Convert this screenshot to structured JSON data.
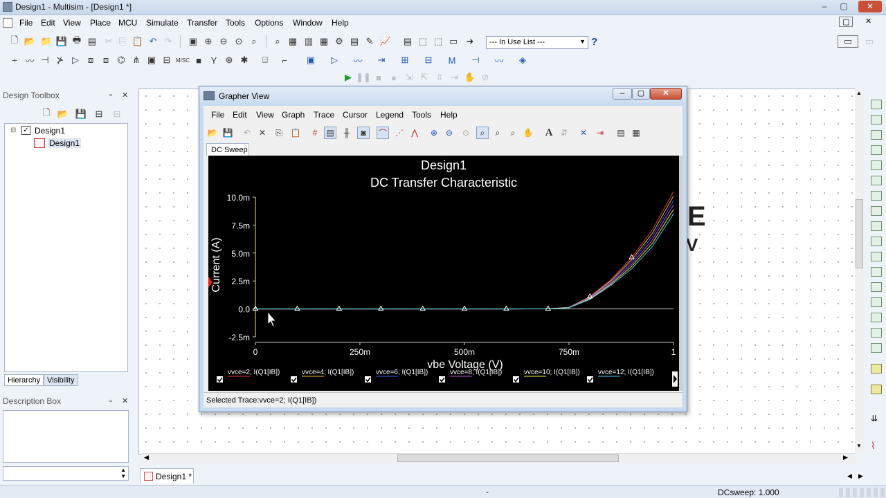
{
  "window": {
    "title": "Design1 - Multisim - [Design1 *]",
    "controls": [
      "–",
      "▢",
      "✕"
    ]
  },
  "menu": [
    "File",
    "Edit",
    "View",
    "Place",
    "MCU",
    "Simulate",
    "Transfer",
    "Tools",
    "Options",
    "Window",
    "Help"
  ],
  "toolbar": {
    "in_use_list": "--- In Use List ---",
    "help": "?"
  },
  "design_toolbox": {
    "title": "Design Toolbox",
    "tree": {
      "root": "Design1",
      "child": "Design1"
    },
    "tabs": [
      "Hierarchy",
      "Visibility"
    ]
  },
  "description_box": {
    "title": "Description Box"
  },
  "workspace": {
    "partial_text": [
      "E",
      "V"
    ]
  },
  "document_tab": "Design1 *",
  "statusbar": {
    "left": "-",
    "right": "DCsweep: 1.000"
  },
  "grapher": {
    "title": "Grapher View",
    "menu": [
      "File",
      "Edit",
      "View",
      "Graph",
      "Trace",
      "Cursor",
      "Legend",
      "Tools",
      "Help"
    ],
    "tab": "DC Sweep",
    "status": "Selected Trace:vvce=2; I(Q1[IB])"
  },
  "chart_data": {
    "type": "line",
    "title": "Design1",
    "subtitle": "DC Transfer Characteristic",
    "xlabel": "vbe Voltage (V)",
    "ylabel": "Current (A)",
    "xlim": [
      0,
      1
    ],
    "ylim": [
      -0.0025,
      0.01
    ],
    "x_ticks": [
      "0",
      "250m",
      "500m",
      "750m",
      "1"
    ],
    "y_ticks": [
      "10.0m",
      "7.5m",
      "5.0m",
      "2.5m",
      "0.0",
      "-2.5m"
    ],
    "grid": false,
    "legend_position": "bottom",
    "x": [
      0,
      0.1,
      0.2,
      0.3,
      0.4,
      0.5,
      0.6,
      0.7,
      0.75,
      0.8,
      0.85,
      0.9,
      0.95,
      1.0
    ],
    "series": [
      {
        "name": "vvce=2; I(Q1[IB])",
        "color": "#e03a3a",
        "values": [
          0,
          0,
          0,
          0,
          0,
          0,
          0,
          1e-05,
          0.00015,
          0.0011,
          0.0026,
          0.0046,
          0.0071,
          0.0105
        ]
      },
      {
        "name": "vvce=4; I(Q1[IB])",
        "color": "#f0b43c",
        "values": [
          0,
          0,
          0,
          0,
          0,
          0,
          0,
          1e-05,
          0.00014,
          0.00105,
          0.0025,
          0.0044,
          0.0068,
          0.0101
        ]
      },
      {
        "name": "vvce=6; I(Q1[IB])",
        "color": "#3a52e8",
        "values": [
          0,
          0,
          0,
          0,
          0,
          0,
          0,
          1e-05,
          0.00013,
          0.001,
          0.0024,
          0.0042,
          0.0065,
          0.0097
        ]
      },
      {
        "name": "vvce=8; I(Q1[IB])",
        "color": "#b655d6",
        "values": [
          0,
          0,
          0,
          0,
          0,
          0,
          0,
          1e-05,
          0.00012,
          0.00095,
          0.0023,
          0.004,
          0.0062,
          0.0093
        ]
      },
      {
        "name": "vvce=10; I(Q1[IB])",
        "color": "#e8e84a",
        "values": [
          0,
          0,
          0,
          0,
          0,
          0,
          0,
          1e-05,
          0.00011,
          0.0009,
          0.0022,
          0.0038,
          0.0059,
          0.0089
        ]
      },
      {
        "name": "vvce=12; I(Q1[IB])",
        "color": "#4ec8e8",
        "values": [
          0,
          0,
          0,
          0,
          0,
          0,
          0,
          1e-05,
          0.0001,
          0.00085,
          0.0021,
          0.0036,
          0.0056,
          0.0085
        ]
      }
    ],
    "markers_x": [
      0,
      0.1,
      0.2,
      0.3,
      0.4,
      0.5,
      0.6,
      0.7,
      0.8,
      0.9
    ]
  }
}
